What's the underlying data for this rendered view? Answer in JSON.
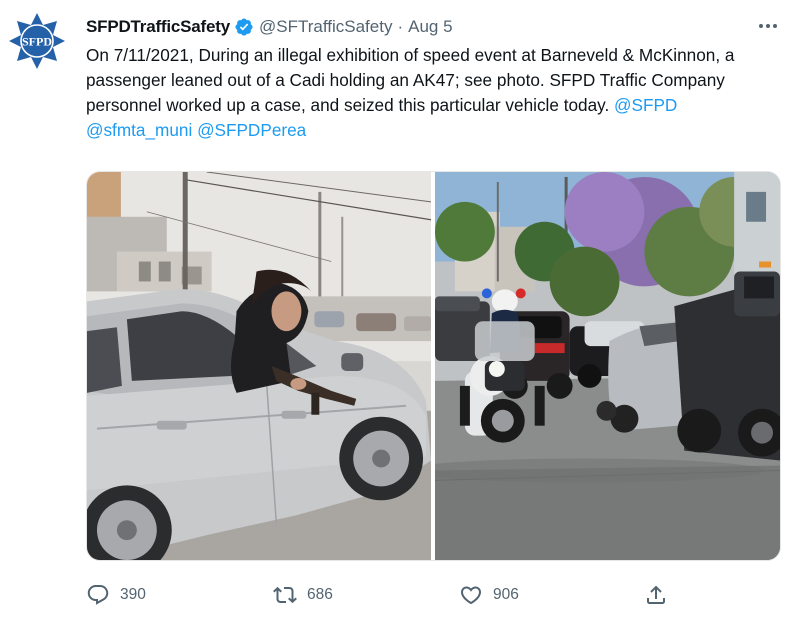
{
  "tweet": {
    "author": {
      "display_name": "SFPDTrafficSafety",
      "handle": "@SFTrafficSafety",
      "verified": true,
      "avatar_text": "SFPD",
      "avatar_color": "#2461a8"
    },
    "separator": "·",
    "date": "Aug 5",
    "text": "On 7/11/2021, During an illegal exhibition of speed event at Barneveld & McKinnon, a passenger leaned out of a Cadi holding an AK47; see photo. SFPD Traffic Company personnel worked up a case, and seized this particular vehicle today.",
    "mentions": [
      "@SFPD",
      "@sfmta_muni",
      "@SFPDPerea"
    ],
    "media": [
      {
        "icon": "photo-silver-car-passenger"
      },
      {
        "icon": "photo-police-motorcycle-street"
      }
    ],
    "actions": {
      "reply_count": "390",
      "retweet_count": "686",
      "like_count": "906"
    },
    "colors": {
      "link": "#1d9bf0",
      "verified": "#1d9bf0",
      "muted": "#536471"
    }
  }
}
